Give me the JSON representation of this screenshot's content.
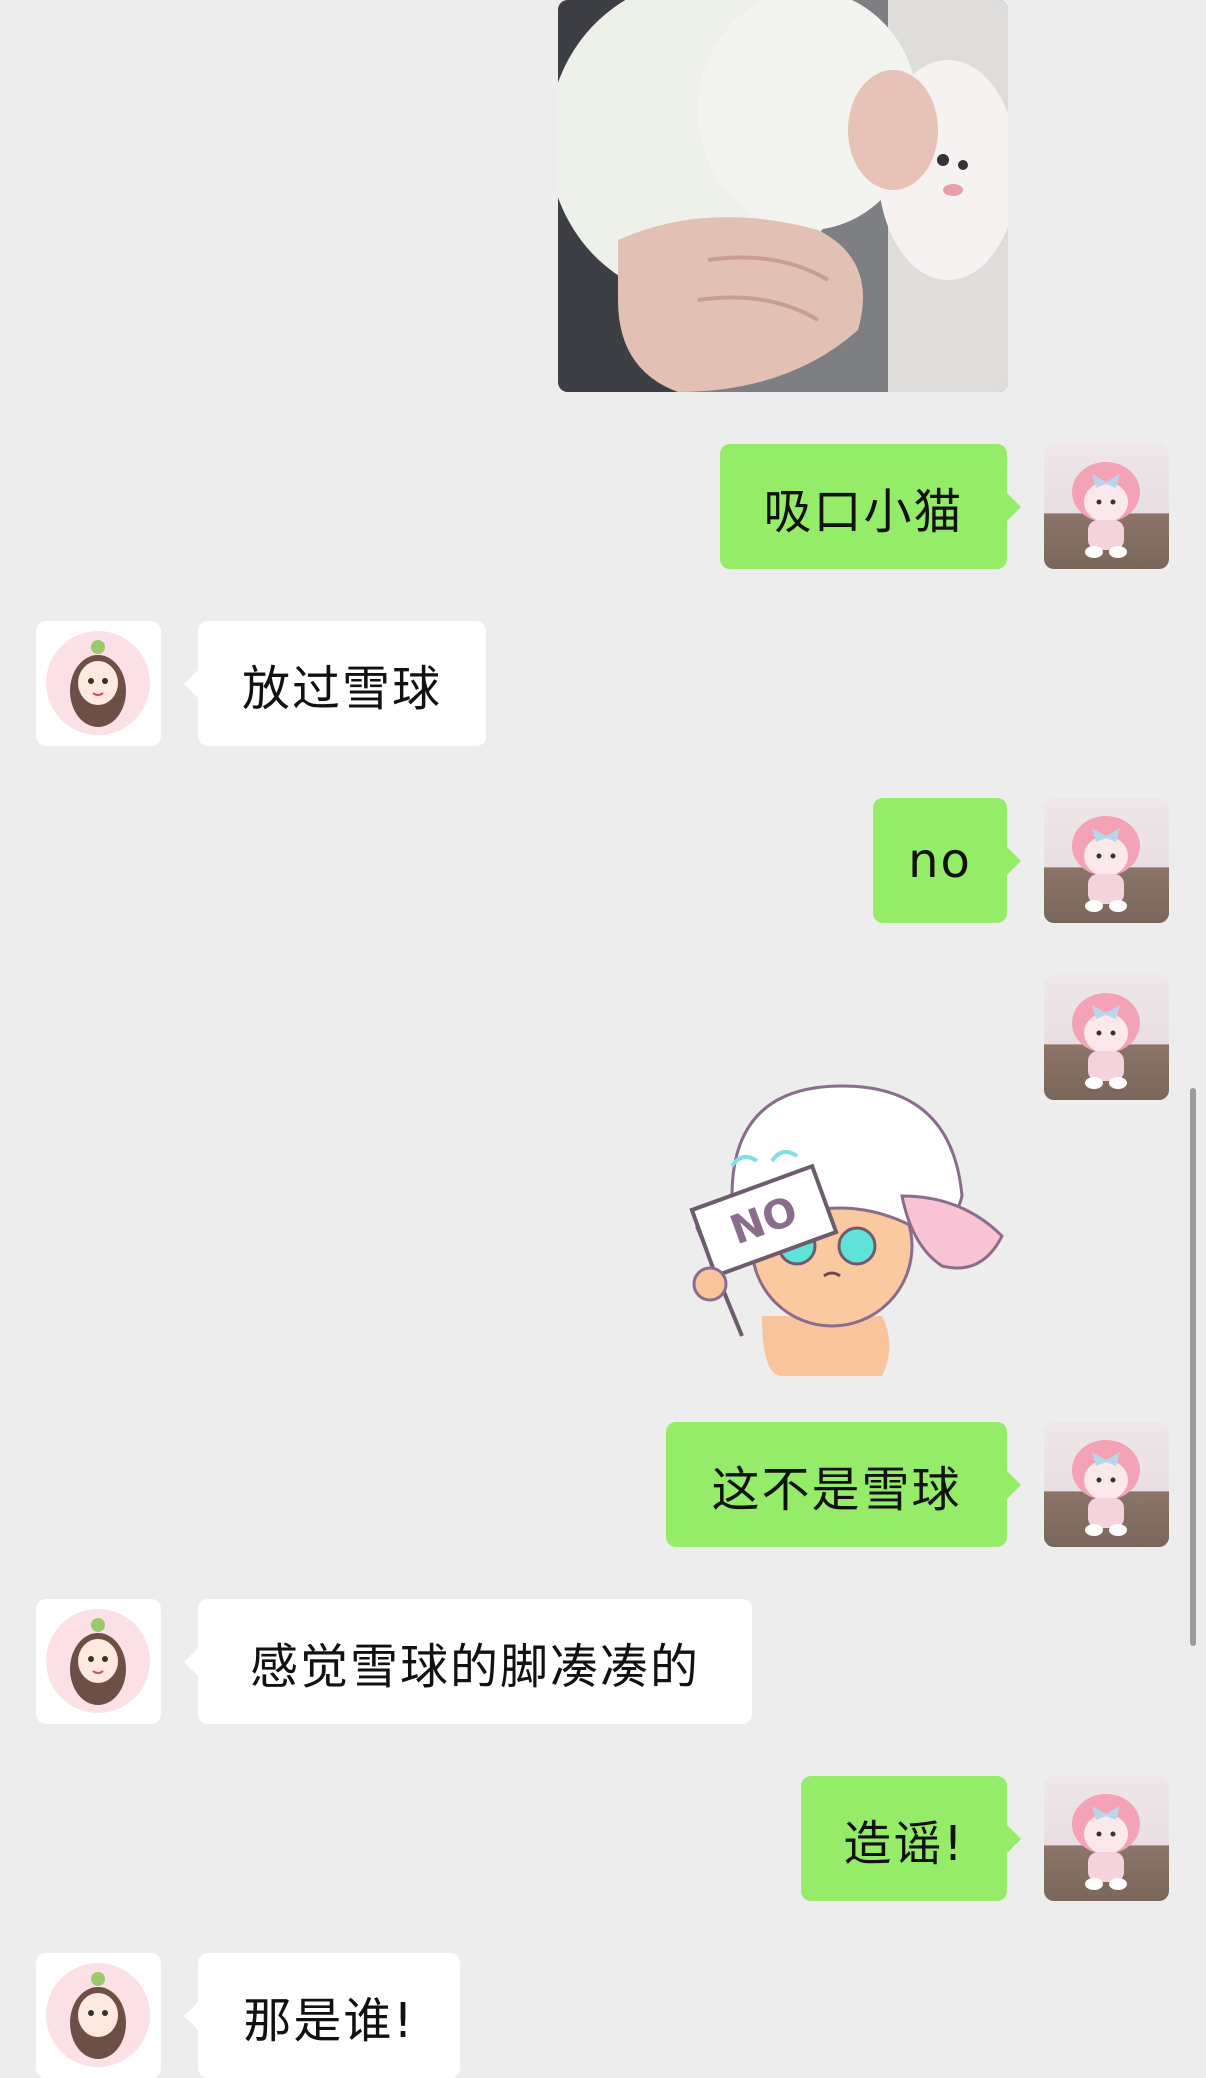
{
  "messages": [
    {
      "side": "me",
      "type": "image",
      "description_icon": "cat-photo"
    },
    {
      "side": "me",
      "type": "text",
      "text": "吸口小猫"
    },
    {
      "side": "other",
      "type": "text",
      "text": "放过雪球"
    },
    {
      "side": "me",
      "type": "text",
      "text": "no"
    },
    {
      "side": "me",
      "type": "sticker",
      "sticker_text": "NO"
    },
    {
      "side": "me",
      "type": "text",
      "text": "这不是雪球"
    },
    {
      "side": "other",
      "type": "text",
      "text": "感觉雪球的脚凑凑的"
    },
    {
      "side": "me",
      "type": "text",
      "text": "造谣!"
    },
    {
      "side": "other",
      "type": "text",
      "text": "那是谁!"
    }
  ],
  "colors": {
    "background": "#ededed",
    "my_bubble": "#95ec69",
    "other_bubble": "#ffffff"
  }
}
